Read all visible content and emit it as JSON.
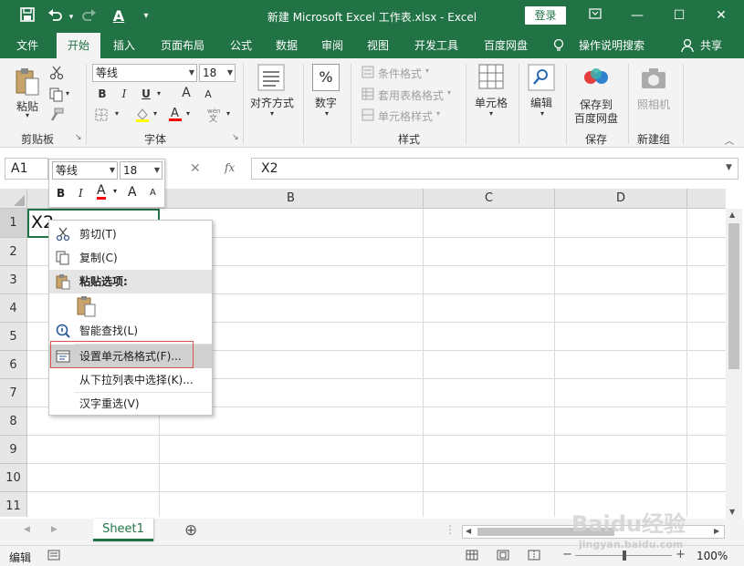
{
  "window": {
    "title": "新建 Microsoft Excel 工作表.xlsx  -  Excel",
    "login_label": "登录",
    "qa": {
      "save": "save-icon",
      "undo": "undo-icon",
      "redo": "redo-icon",
      "font": "A"
    },
    "controls": {
      "restore_ribbon": "ribbon-display-icon",
      "minimize": "—",
      "maximize": "☐",
      "close": "✕"
    }
  },
  "tabs": [
    "文件",
    "开始",
    "插入",
    "页面布局",
    "公式",
    "数据",
    "审阅",
    "视图",
    "开发工具",
    "百度网盘"
  ],
  "tell_me": "操作说明搜索",
  "share": "共享",
  "ribbon": {
    "paste_label": "粘贴",
    "group_clipboard": "剪贴板",
    "font_name": "等线",
    "font_size": "18",
    "bold": "B",
    "italic": "I",
    "underline": "U",
    "grow": "A",
    "shrink": "A",
    "group_font": "字体",
    "align_label": "对齐方式",
    "number_label": "数字",
    "percent": "%",
    "cond_format": "条件格式",
    "table_format": "套用表格格式",
    "cell_style": "单元格样式",
    "group_style": "样式",
    "cells_label": "单元格",
    "edit_label": "编辑",
    "save_baidu": "保存到",
    "save_baidu2": "百度网盘",
    "group_save": "保存",
    "camera_label": "照相机",
    "group_new": "新建组"
  },
  "formula": {
    "namebox": "A1",
    "cancel": "✕",
    "enter": "✓",
    "fx": "fx",
    "value": "X2"
  },
  "minibar": {
    "font": "等线",
    "size": "18",
    "bold": "B",
    "italic": "I",
    "color": "A",
    "grow": "A",
    "shrink": "A"
  },
  "columns": [
    "B",
    "C",
    "D"
  ],
  "rows": [
    "1",
    "2",
    "3",
    "4",
    "5",
    "6",
    "7",
    "8",
    "9",
    "10",
    "11"
  ],
  "cell_a1": "X2",
  "context_menu": {
    "cut": "剪切(T)",
    "copy": "复制(C)",
    "paste_options": "粘贴选项:",
    "smart_lookup": "智能查找(L)",
    "format_cells": "设置单元格格式(F)...",
    "pick_list": "从下拉列表中选择(K)...",
    "hanzi": "汉字重选(V)"
  },
  "sheet": {
    "tab": "Sheet1",
    "add": "⊕"
  },
  "status": {
    "mode": "编辑",
    "zoom": "100%"
  },
  "watermark": {
    "line1": "Baidu经验",
    "line2": "jingyan.baidu.com"
  },
  "colors": {
    "excel_green": "#217346",
    "highlight_border": "#d9534f"
  }
}
